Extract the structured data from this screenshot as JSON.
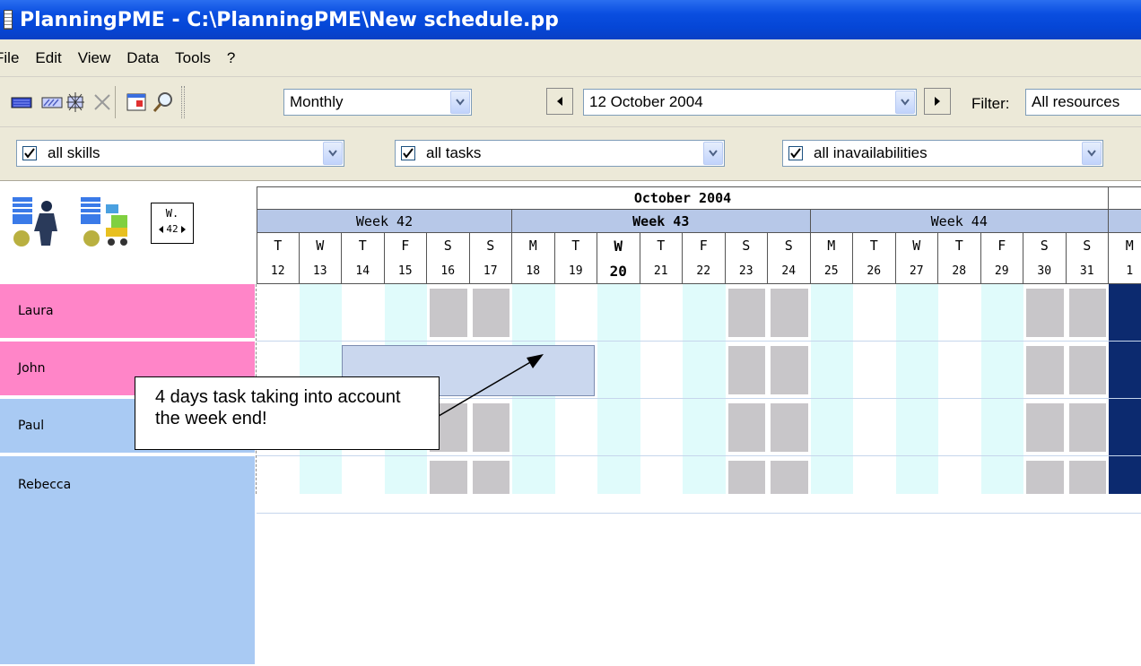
{
  "window": {
    "title": "PlanningPME - C:\\PlanningPME\\New schedule.pp"
  },
  "menu": [
    "File",
    "Edit",
    "View",
    "Data",
    "Tools",
    "?"
  ],
  "toolbar": {
    "view_mode": "Monthly",
    "date": "12  October  2004",
    "filter_label": "Filter:",
    "filter_value": "All resources"
  },
  "filters": {
    "skills": "all skills",
    "tasks": "all tasks",
    "inavailabilities": "all inavailabilities"
  },
  "week_nav": {
    "label": "W.",
    "value": "42"
  },
  "calendar": {
    "month": "October 2004",
    "weeks": [
      {
        "label": "Week 42",
        "bold": false
      },
      {
        "label": "Week 43",
        "bold": true
      },
      {
        "label": "Week 44",
        "bold": false
      }
    ],
    "days": [
      {
        "l": "T",
        "n": "12",
        "type": "white"
      },
      {
        "l": "W",
        "n": "13",
        "type": "cyan"
      },
      {
        "l": "T",
        "n": "14",
        "type": "white"
      },
      {
        "l": "F",
        "n": "15",
        "type": "cyan"
      },
      {
        "l": "S",
        "n": "16",
        "type": "weekend"
      },
      {
        "l": "S",
        "n": "17",
        "type": "weekend"
      },
      {
        "l": "M",
        "n": "18",
        "type": "cyan"
      },
      {
        "l": "T",
        "n": "19",
        "type": "white"
      },
      {
        "l": "W",
        "n": "20",
        "type": "cyan",
        "today": true
      },
      {
        "l": "T",
        "n": "21",
        "type": "white"
      },
      {
        "l": "F",
        "n": "22",
        "type": "cyan"
      },
      {
        "l": "S",
        "n": "23",
        "type": "weekend"
      },
      {
        "l": "S",
        "n": "24",
        "type": "weekend"
      },
      {
        "l": "M",
        "n": "25",
        "type": "cyan"
      },
      {
        "l": "T",
        "n": "26",
        "type": "white"
      },
      {
        "l": "W",
        "n": "27",
        "type": "cyan"
      },
      {
        "l": "T",
        "n": "28",
        "type": "white"
      },
      {
        "l": "F",
        "n": "29",
        "type": "cyan"
      },
      {
        "l": "S",
        "n": "30",
        "type": "weekend"
      },
      {
        "l": "S",
        "n": "31",
        "type": "weekend"
      },
      {
        "l": "M",
        "n": "1",
        "type": "dark"
      }
    ]
  },
  "resources": [
    {
      "name": "Laura",
      "color": "#ff85c8"
    },
    {
      "name": "John",
      "color": "#ff85c8"
    },
    {
      "name": "Paul",
      "color": "#a9caf3"
    },
    {
      "name": "Rebecca",
      "color": "#a9caf3"
    }
  ],
  "annotation": {
    "text": "4 days task taking into account the week end!"
  },
  "colors": {
    "cyan": "#e0fbfb",
    "weekend": "#c8c6c9",
    "dark": "#0c2a6f",
    "task": "#cad7ee"
  }
}
